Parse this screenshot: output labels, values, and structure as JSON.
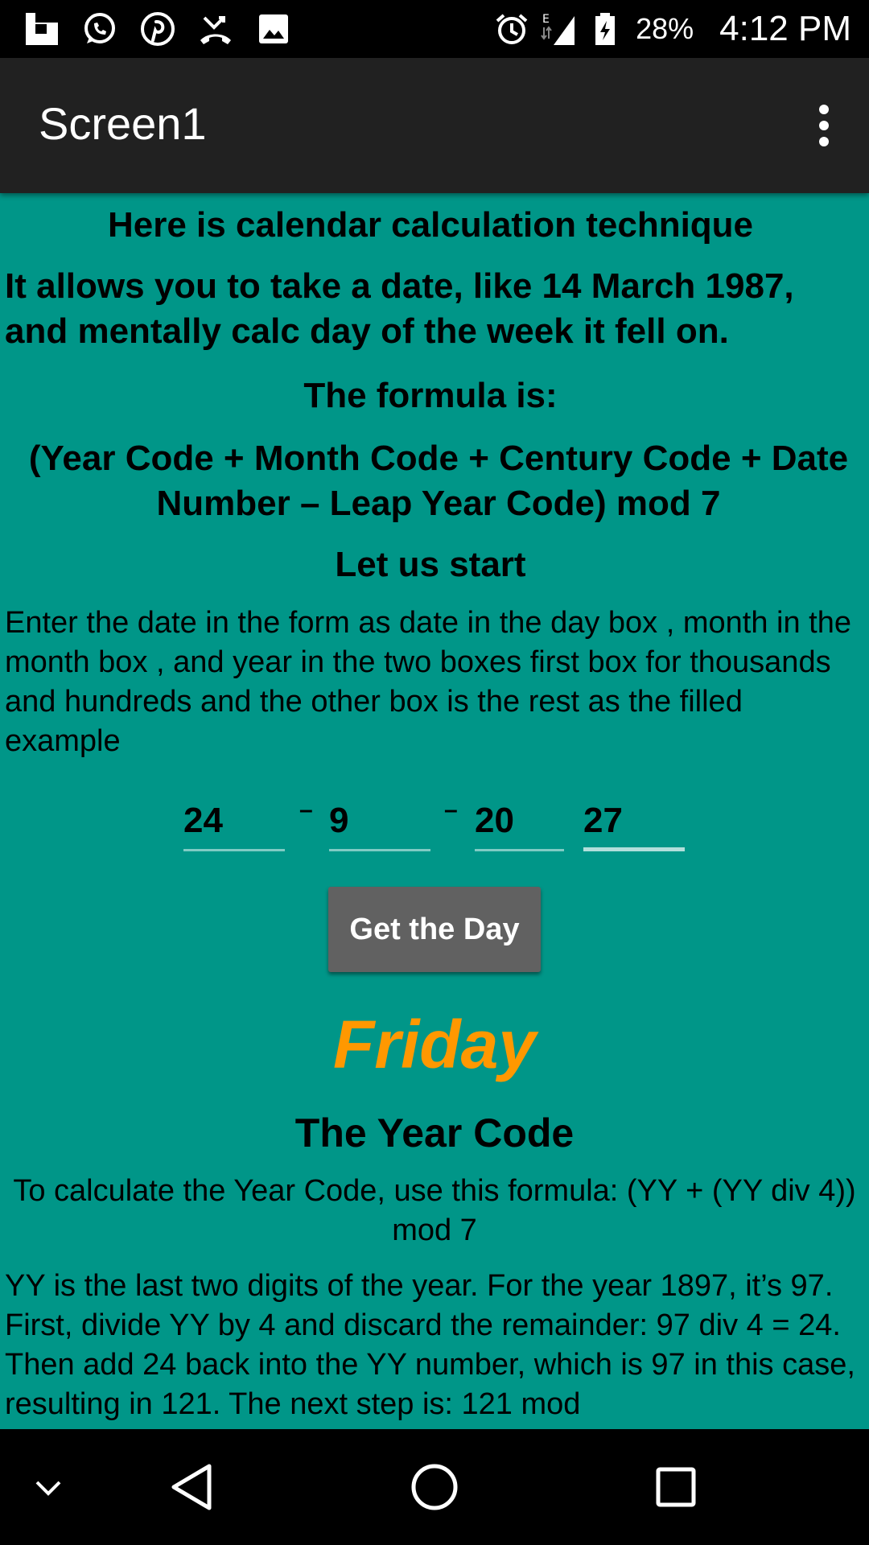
{
  "status_bar": {
    "battery": "28%",
    "time": "4:12 PM",
    "left_icons": [
      "flipboard-icon",
      "whatsapp-icon",
      "pinterest-icon",
      "missed-call-icon",
      "image-icon"
    ],
    "right_icons": [
      "alarm-icon",
      "signal-icon",
      "battery-charging-icon"
    ]
  },
  "app_bar": {
    "title": "Screen1"
  },
  "content": {
    "heading_intro": "Here is calendar calculation technique",
    "intro_text": "It allows you to take a date, like 14 March 1987, and mentally calc day of the week it fell on.",
    "formula_heading": "The formula is:",
    "formula_text": "(Year Code + Month Code + Century Code + Date Number – Leap Year Code) mod 7",
    "start_heading": "Let us start",
    "instructions": "Enter the date in the form as date in the day box , month in the month box , and year in the two boxes first box for thousands and hundreds and the other box is the rest as the filled example",
    "date_inputs": {
      "day": "24",
      "month": "9",
      "year_century": "20",
      "year_rest": "27",
      "separator": "–"
    },
    "button_label": "Get the Day",
    "result_day": "Friday",
    "year_code_heading": "The Year Code",
    "year_code_formula": "To calculate the Year Code, use this formula:  (YY + (YY div 4)) mod 7",
    "year_code_explanation": "YY is the last two digits of the year. For the year 1897, it’s 97.  First, divide YY by 4 and discard the remainder: 97 div 4 = 24.  Then add 24 back into the YY number, which is 97 in this case, resulting in 121.  The next step is: 121 mod"
  },
  "colors": {
    "background": "#009688",
    "app_bar": "#212121",
    "result": "#ff9800",
    "button": "#616161"
  }
}
